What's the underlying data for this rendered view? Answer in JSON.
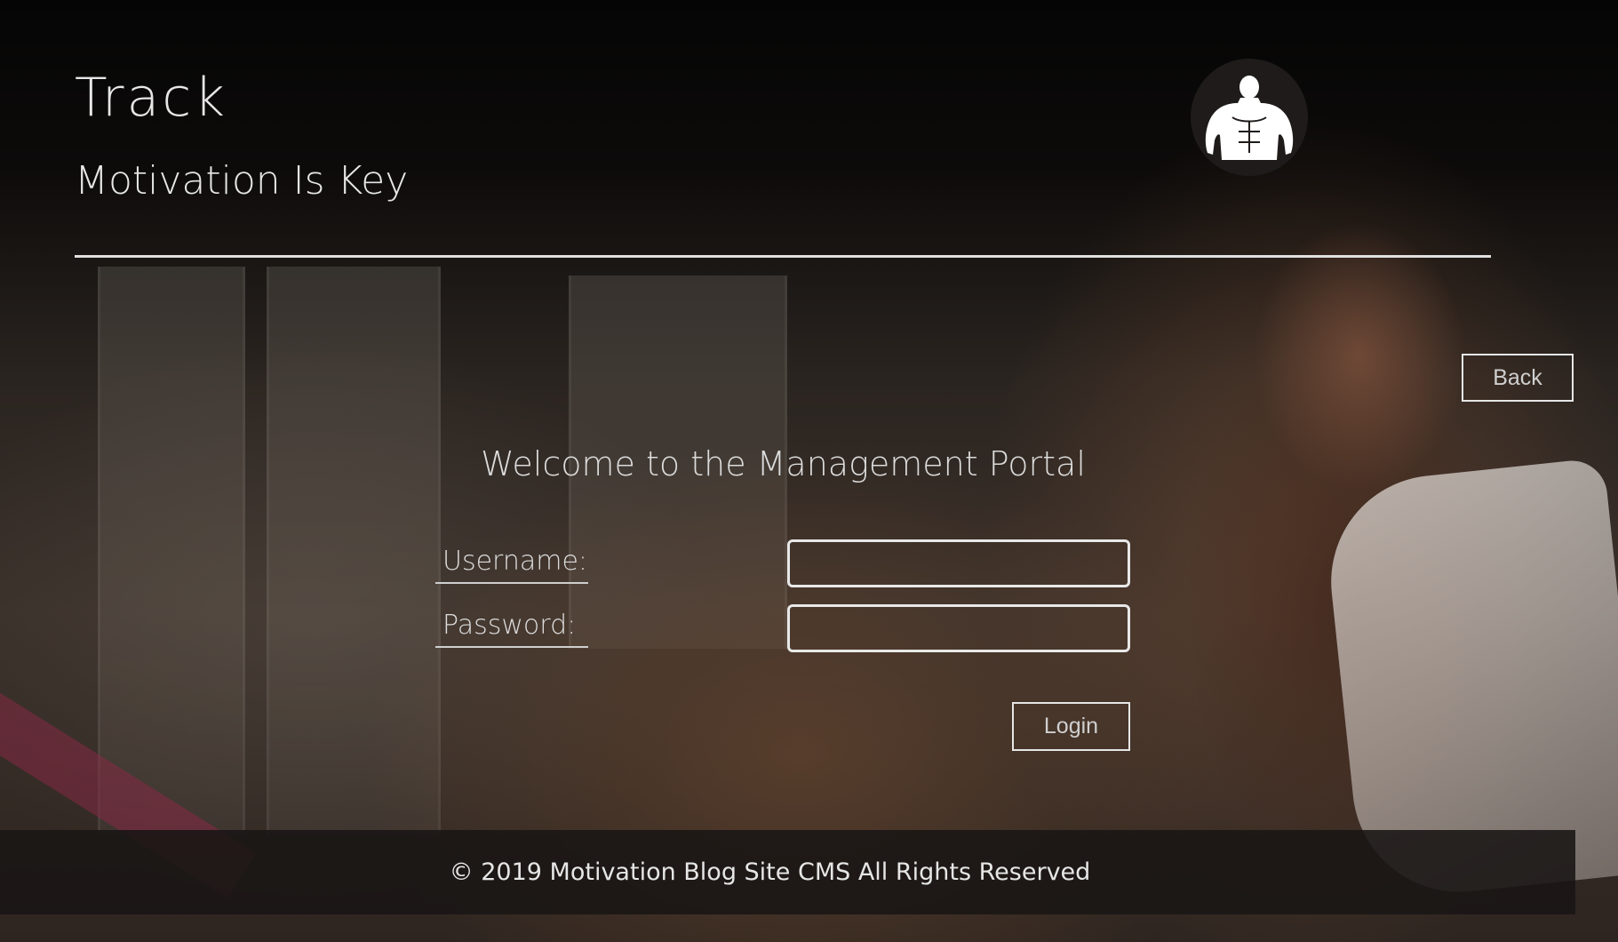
{
  "header": {
    "title": "Track",
    "tagline": "Motivation Is Key",
    "logo_icon": "bodybuilder-icon"
  },
  "nav": {
    "back_label": "Back"
  },
  "login_form": {
    "heading": "Welcome to the Management Portal",
    "username_label": "Username:",
    "username_value": "",
    "password_label": "Password:",
    "password_value": "",
    "submit_label": "Login"
  },
  "footer": {
    "copyright": "© 2019 Motivation Blog Site CMS All Rights Reserved"
  },
  "colors": {
    "text": "#e6e6e6",
    "border": "#e8e8e8",
    "footer_bg": "#191614"
  }
}
